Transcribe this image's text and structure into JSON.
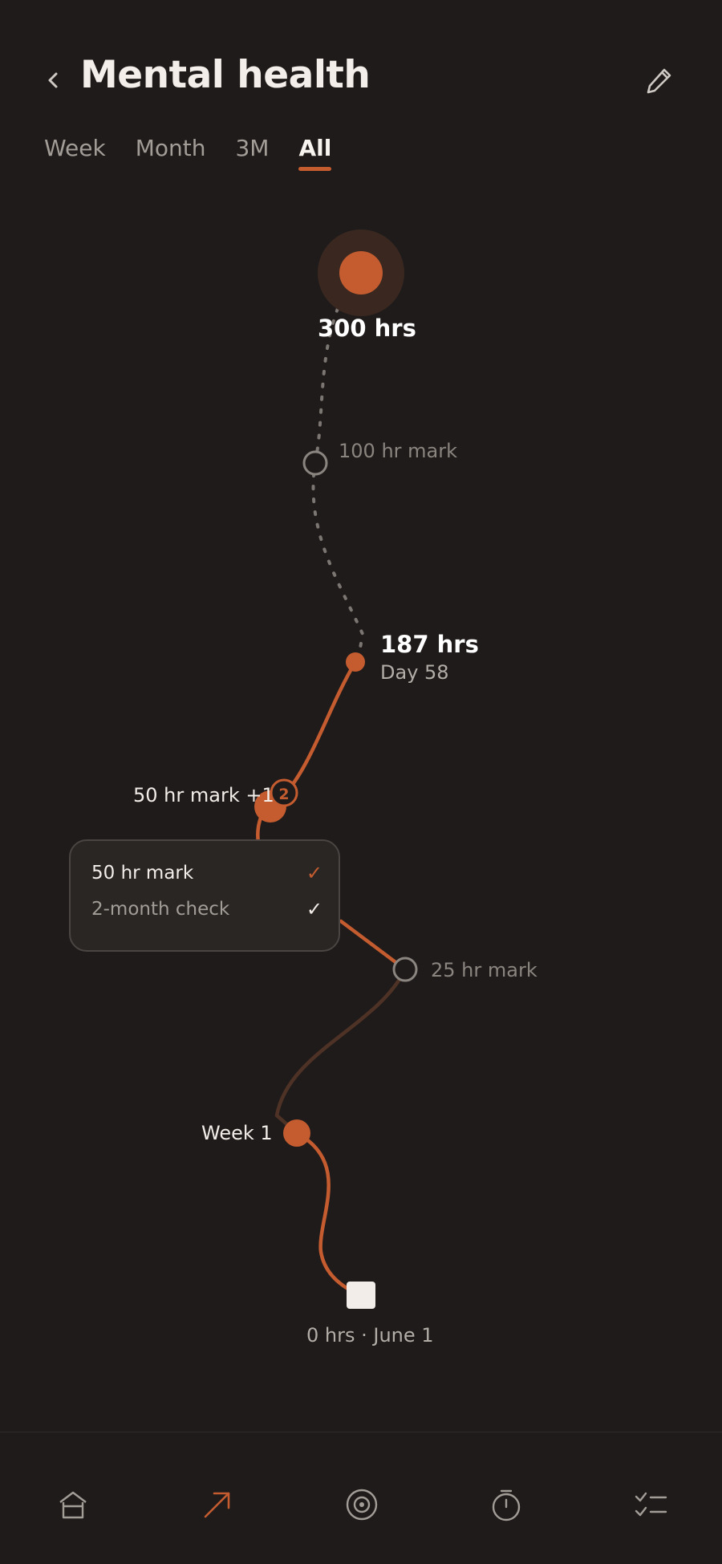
{
  "header": {
    "title": "Mental health"
  },
  "tabs": [
    {
      "label": "Week"
    },
    {
      "label": "Month"
    },
    {
      "label": "3M"
    },
    {
      "label": "All",
      "active": true
    }
  ],
  "timeline": {
    "goal": {
      "label": "300 hrs"
    },
    "milestone_100": {
      "label": "100 hr mark"
    },
    "current": {
      "value": "187 hrs",
      "day": "Day 58"
    },
    "milestone_50": {
      "label": "50 hr mark +1",
      "badge": "2"
    },
    "milestone_25": {
      "label": "25 hr mark"
    },
    "week1": {
      "label": "Week 1"
    },
    "start": {
      "label": "0 hrs · June 1"
    }
  },
  "popover": {
    "items": [
      {
        "label": "50 hr mark",
        "check": "✓"
      },
      {
        "label": "2-month check",
        "check": "✓"
      }
    ]
  },
  "bottom_nav": {
    "items": [
      {
        "icon": "home-icon"
      },
      {
        "icon": "trend-arrow-icon",
        "active": true
      },
      {
        "icon": "target-icon"
      },
      {
        "icon": "timer-icon"
      },
      {
        "icon": "checklist-icon"
      }
    ]
  },
  "colors": {
    "accent": "#c45c30",
    "background": "#1f1b1a",
    "text": "#f2ede8",
    "muted": "#8b8580"
  }
}
